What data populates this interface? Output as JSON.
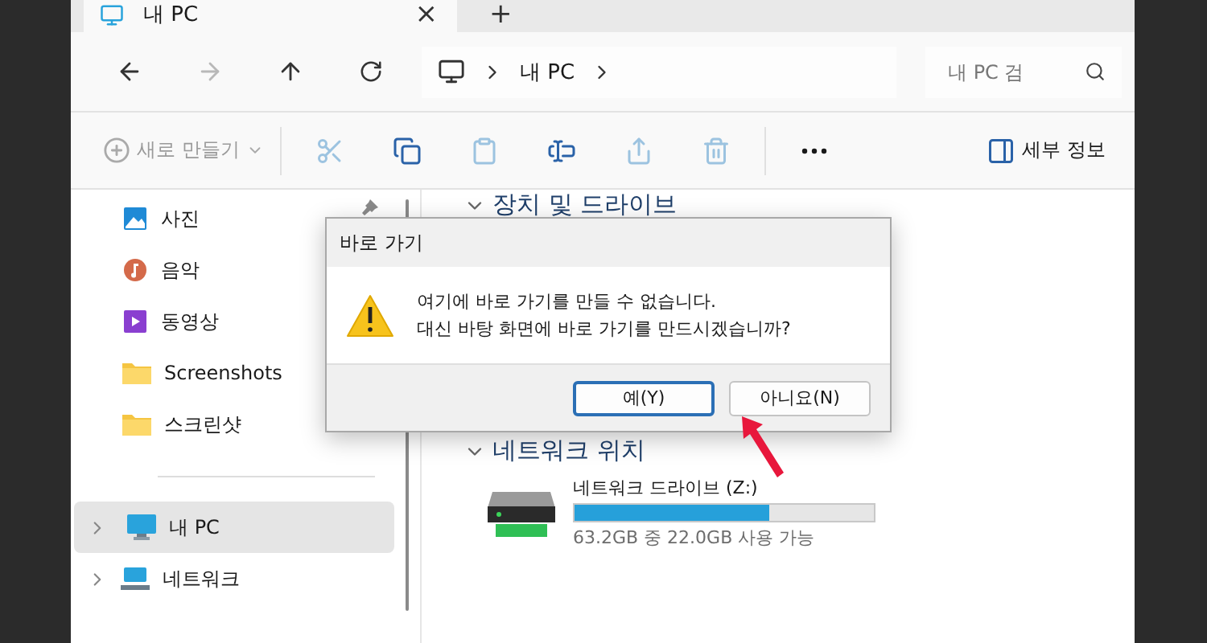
{
  "tab": {
    "title": "내 PC",
    "close": "×",
    "new_tab": "+"
  },
  "navigation": {
    "back_disabled": false,
    "forward_disabled": true,
    "breadcrumb": [
      "내 PC"
    ],
    "search": {
      "placeholder": "내 PC 검"
    }
  },
  "toolbar": [
    {
      "kind": "menu",
      "label": "새로 만들기",
      "disabled": true
    },
    {
      "kind": "icon",
      "disabled": true
    },
    {
      "kind": "icon",
      "disabled": false
    },
    {
      "kind": "icon",
      "disabled": true
    },
    {
      "kind": "icon",
      "disabled": false
    },
    {
      "kind": "icon",
      "disabled": true
    },
    {
      "kind": "icon",
      "disabled": true
    },
    {
      "kind": "more"
    },
    {
      "kind": "details",
      "label": "세부 정보"
    }
  ],
  "sidebar": {
    "items": [
      {
        "label": "사진",
        "kind": "pictures",
        "selected": false,
        "pinned": true
      },
      {
        "label": "음악",
        "kind": "music",
        "selected": false
      },
      {
        "label": "동영상",
        "kind": "videos",
        "selected": false
      },
      {
        "label": "Screenshots",
        "kind": "folder",
        "selected": false
      },
      {
        "label": "스크린샷",
        "kind": "folder",
        "selected": false
      },
      {
        "kind": "divider"
      },
      {
        "label": "내 PC",
        "kind": "pc",
        "selected": true,
        "expandable": true
      },
      {
        "label": "네트워크",
        "kind": "network",
        "selected": false,
        "expandable": true
      }
    ]
  },
  "main": {
    "sections": [
      {
        "title": "장치 및 드라이브",
        "expanded": true
      },
      {
        "title": "네트워크 위치",
        "expanded": true,
        "drives": [
          {
            "name": "네트워크 드라이브 (Z:)",
            "level": 0.65,
            "space": "63.2GB 중 22.0GB 사용 가능"
          }
        ]
      }
    ]
  },
  "dialog": {
    "title": "바로 가기",
    "message": [
      "여기에 바로 가기를 만들 수 없습니다.",
      "대신 바탕 화면에 바로 가기를 만드시겠습니까?"
    ],
    "buttons": [
      {
        "label": "예(Y)",
        "default": true
      },
      {
        "label": "아니요(N)",
        "default": false
      }
    ]
  },
  "annotation": {
    "kind": "arrow",
    "color": "#e8173c"
  }
}
